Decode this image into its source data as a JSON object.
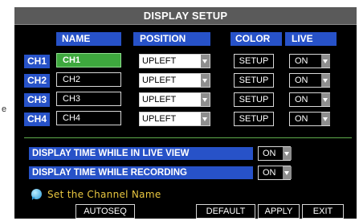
{
  "left_fragment": "e",
  "dialog": {
    "title": "DISPLAY SETUP",
    "columns": [
      "NAME",
      "POSITION",
      "COLOR",
      "LIVE"
    ],
    "channels": [
      {
        "label": "CH1",
        "name": "CH1",
        "position": "UPLEFT",
        "color_button": "SETUP",
        "live": "ON",
        "selected": true
      },
      {
        "label": "CH2",
        "name": "CH2",
        "position": "UPLEFT",
        "color_button": "SETUP",
        "live": "ON",
        "selected": false
      },
      {
        "label": "CH3",
        "name": "CH3",
        "position": "UPLEFT",
        "color_button": "SETUP",
        "live": "ON",
        "selected": false
      },
      {
        "label": "CH4",
        "name": "CH4",
        "position": "UPLEFT",
        "color_button": "SETUP",
        "live": "ON",
        "selected": false
      }
    ],
    "options": [
      {
        "label": "DISPLAY TIME WHILE IN LIVE VIEW",
        "value": "ON"
      },
      {
        "label": "DISPLAY TIME WHILE RECORDING",
        "value": "ON"
      }
    ],
    "hint": {
      "icon": "info-bubble-icon",
      "text": "Set the Channel Name"
    },
    "buttons": {
      "autoseq": "AUTOSEQ",
      "default": "DEFAULT",
      "apply": "APPLY",
      "exit": "EXIT"
    }
  },
  "colors": {
    "header_blue": "#2752c8",
    "selected_green": "#3ea83e",
    "hint_yellow": "#e8c640",
    "title_gray": "#5a5a5a",
    "separator_green": "#5fae4c"
  }
}
